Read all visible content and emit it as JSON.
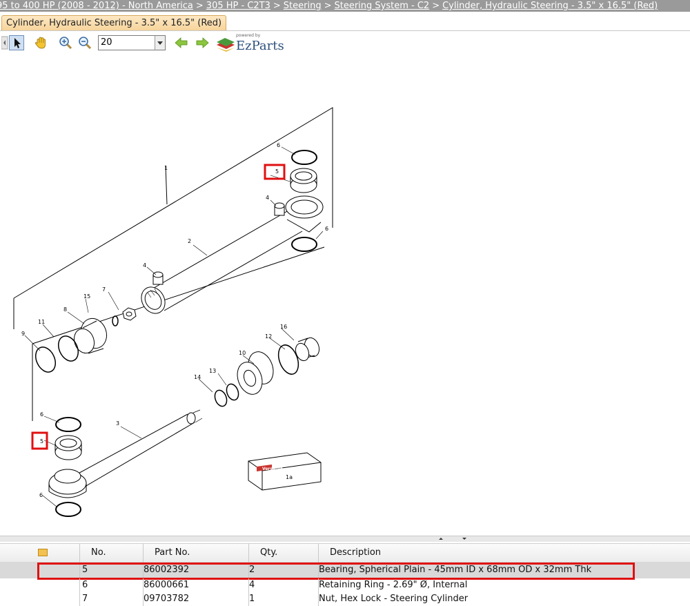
{
  "breadcrumb": {
    "items": [
      "95 to 400 HP (2008 - 2012) - North America",
      "305 HP - C2T3",
      "Steering",
      "Steering System - C2",
      "Cylinder, Hydraulic Steering - 3.5\" x 16.5\" (Red)"
    ],
    "separator": ">"
  },
  "tab": {
    "label": "Cylinder, Hydraulic Steering - 3.5\" x 16.5\" (Red)"
  },
  "toolbar": {
    "zoom_value": "20",
    "powered_by": "powered by",
    "brand": "EzParts"
  },
  "diagram": {
    "callouts": {
      "n1": "1",
      "n2": "2",
      "n3": "3",
      "n4a": "4",
      "n4b": "4",
      "n5a": "5",
      "n5b": "5",
      "n6a": "6",
      "n6b": "6",
      "n6c": "6",
      "n6d": "6",
      "n7": "7",
      "n8": "8",
      "n9": "9",
      "n10": "10",
      "n11": "11",
      "n12": "12",
      "n13": "13",
      "n14": "14",
      "n15": "15",
      "n16": "16",
      "n1a": "1a"
    },
    "kit_brand": "Versatile",
    "highlight_color": "#e01010"
  },
  "table": {
    "headers": {
      "no": "No.",
      "part": "Part No.",
      "qty": "Qty.",
      "desc": "Description"
    },
    "rows": [
      {
        "no": "5",
        "part": "86002392",
        "qty": "2",
        "desc": "Bearing, Spherical Plain - 45mm ID x 68mm OD x 32mm Thk"
      },
      {
        "no": "6",
        "part": "86000661",
        "qty": "4",
        "desc": "Retaining Ring - 2.69\" Ø, Internal"
      },
      {
        "no": "7",
        "part": "09703782",
        "qty": "1",
        "desc": "Nut, Hex Lock - Steering Cylinder"
      }
    ]
  }
}
